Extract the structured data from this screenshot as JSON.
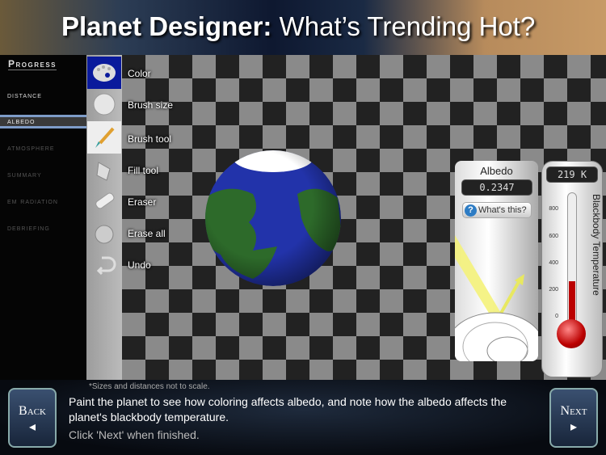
{
  "header": {
    "title_bold": "Planet Designer:",
    "title_rest": " What’s Trending Hot?"
  },
  "progress": {
    "title": "Progress",
    "steps": [
      {
        "label": "Distance",
        "state": "done"
      },
      {
        "label": "Albedo",
        "state": "active"
      },
      {
        "label": "Atmosphere",
        "state": "todo"
      },
      {
        "label": "Summary",
        "state": "todo"
      },
      {
        "label": "EM radiation",
        "state": "todo"
      },
      {
        "label": "Debriefing",
        "state": "todo"
      }
    ]
  },
  "tools": [
    {
      "label": "Color",
      "icon": "palette-icon"
    },
    {
      "label": "Brush size",
      "icon": "brush-size-icon"
    },
    {
      "label": "Brush tool",
      "icon": "paintbrush-icon"
    },
    {
      "label": "Fill tool",
      "icon": "paint-bucket-icon"
    },
    {
      "label": "Eraser",
      "icon": "eraser-icon"
    },
    {
      "label": "Erase all",
      "icon": "bomb-icon"
    },
    {
      "label": "Undo",
      "icon": "undo-icon"
    }
  ],
  "albedo": {
    "title": "Albedo",
    "value": "0.2347",
    "help": "What's this?"
  },
  "thermometer": {
    "readout": "219 K",
    "label": "Blackbody Temperature",
    "ticks": [
      "800",
      "600",
      "400",
      "200",
      "0"
    ],
    "value_k": 219,
    "max_k": 900
  },
  "bottom": {
    "note": "*Sizes and distances not to scale.",
    "instruction": "Paint the planet to see how coloring affects albedo, and note how the albedo affects the planet's blackbody temperature.",
    "instruction2": "Click 'Next' when finished.",
    "back": "Back",
    "next": "Next"
  }
}
